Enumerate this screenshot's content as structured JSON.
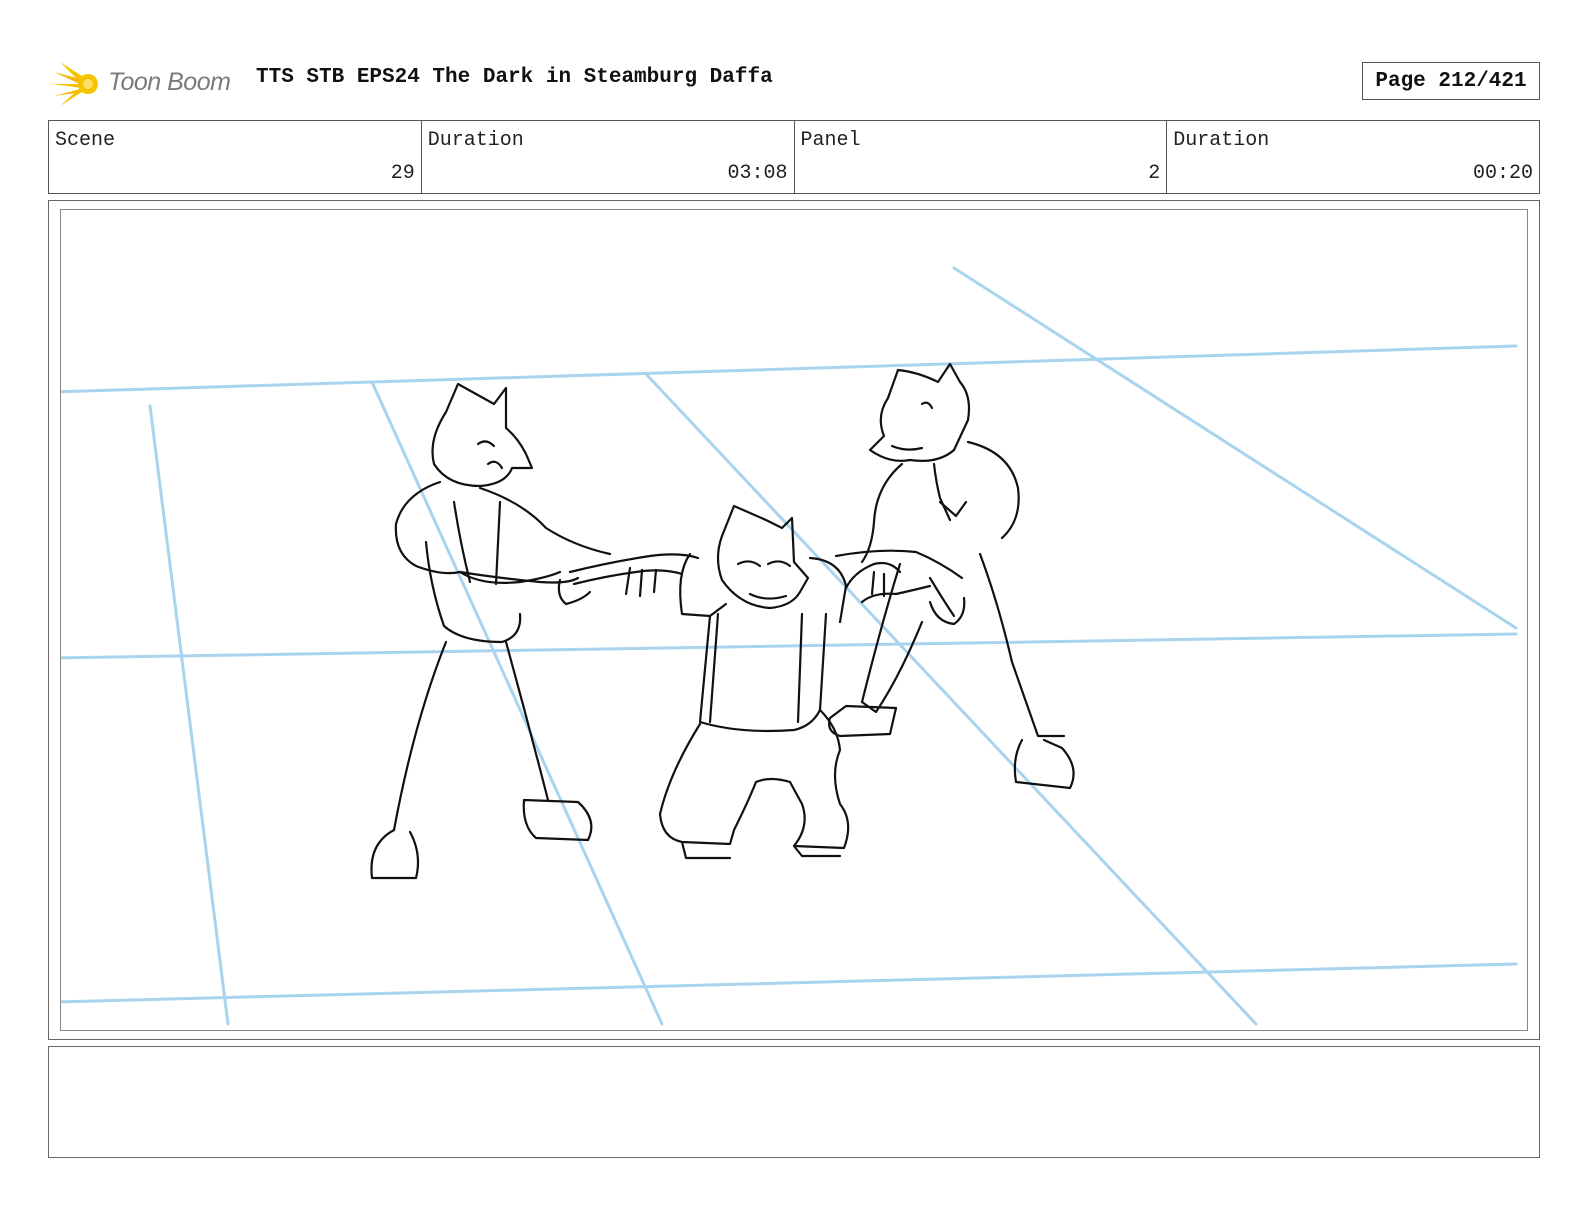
{
  "header": {
    "logo_text": "Toon Boom",
    "title": "TTS STB EPS24 The Dark in Steamburg Daffa",
    "page_label": "Page 212/421"
  },
  "info": [
    {
      "label": "Scene",
      "value": "29"
    },
    {
      "label": "Duration",
      "value": "03:08"
    },
    {
      "label": "Panel",
      "value": "2"
    },
    {
      "label": "Duration",
      "value": "00:20"
    }
  ],
  "colors": {
    "guide_lines": "#a8d4ee",
    "sketch": "#111111",
    "logo_accent": "#f5c400"
  },
  "panel": {
    "drawing": "sketch of three wolf characters; two pulling the arms of a kneeling one"
  },
  "notes": {
    "text": ""
  }
}
